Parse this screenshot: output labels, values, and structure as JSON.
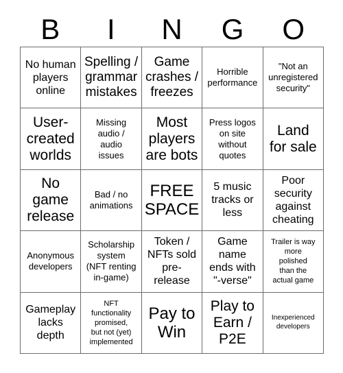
{
  "card": {
    "title_letters": [
      "B",
      "I",
      "N",
      "G",
      "O"
    ],
    "colors": {
      "background": "#ffffff",
      "text": "#000000",
      "grid_line": "#6b6b6b"
    },
    "rows": [
      [
        {
          "text": "No human\nplayers\nonline",
          "size": "md"
        },
        {
          "text": "Spelling /\ngrammar\nmistakes",
          "size": "lg"
        },
        {
          "text": "Game\ncrashes /\nfreezes",
          "size": "lg"
        },
        {
          "text": "Horrible\nperformance",
          "size": "sm"
        },
        {
          "text": "\"Not an\nunregistered\nsecurity\"",
          "size": "sm"
        }
      ],
      [
        {
          "text": "User-\ncreated\nworlds",
          "size": "xl"
        },
        {
          "text": "Missing\naudio /\naudio\nissues",
          "size": "sm"
        },
        {
          "text": "Most\nplayers\nare bots",
          "size": "xl"
        },
        {
          "text": "Press logos\non site\nwithout\nquotes",
          "size": "sm"
        },
        {
          "text": "Land\nfor sale",
          "size": "xl"
        }
      ],
      [
        {
          "text": "No\ngame\nrelease",
          "size": "xl"
        },
        {
          "text": "Bad / no\nanimations",
          "size": "sm"
        },
        {
          "text": "FREE\nSPACE",
          "size": "xxl"
        },
        {
          "text": "5 music\ntracks or\nless",
          "size": "md"
        },
        {
          "text": "Poor\nsecurity\nagainst\ncheating",
          "size": "md"
        }
      ],
      [
        {
          "text": "Anonymous\ndevelopers",
          "size": "sm"
        },
        {
          "text": "Scholarship\nsystem\n(NFT renting\nin-game)",
          "size": "sm"
        },
        {
          "text": "Token /\nNFTs sold\npre-\nrelease",
          "size": "md"
        },
        {
          "text": "Game\nname\nends with\n\"-verse\"",
          "size": "md"
        },
        {
          "text": "Trailer is way\nmore\npolished\nthan the\nactual game",
          "size": "xs"
        }
      ],
      [
        {
          "text": "Gameplay\nlacks\ndepth",
          "size": "md"
        },
        {
          "text": "NFT\nfunctionality\npromised,\nbut not (yet)\nimplemented",
          "size": "xs"
        },
        {
          "text": "Pay to\nWin",
          "size": "xxl"
        },
        {
          "text": "Play to\nEarn /\nP2E",
          "size": "xl"
        },
        {
          "text": "Inexperienced\ndevelopers",
          "size": "xxs"
        }
      ]
    ]
  }
}
